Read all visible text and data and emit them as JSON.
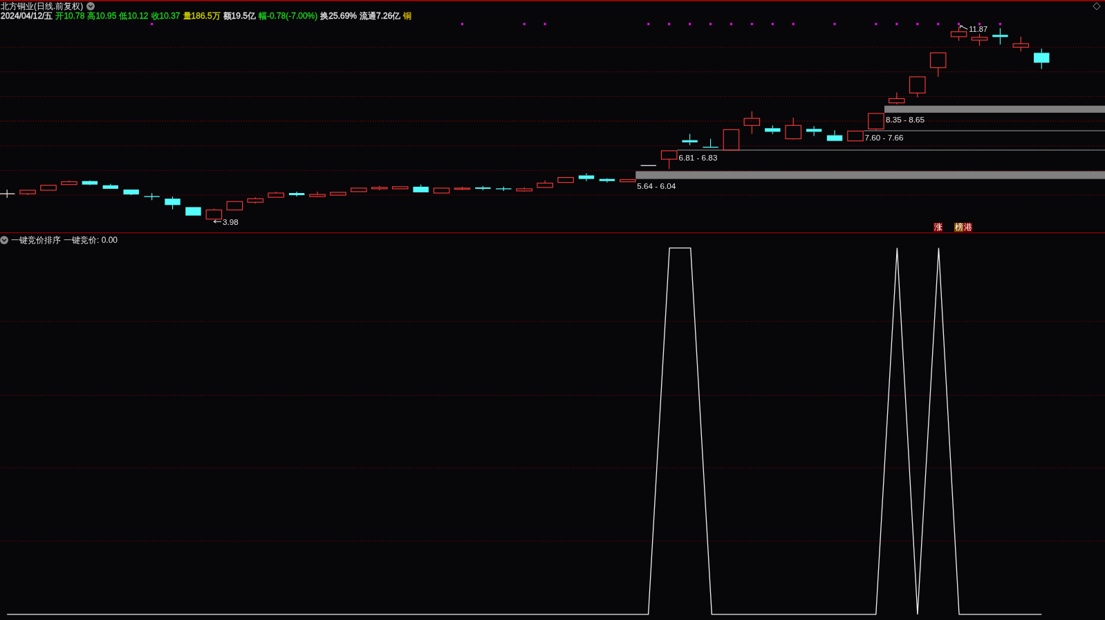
{
  "title_bar": {
    "title": "北方铜业(日线.前复权)"
  },
  "quote": [
    {
      "text": "2024/04/12/五",
      "color": "#e6e6e6"
    },
    {
      "text": "开10.78",
      "color": "#1ed31e"
    },
    {
      "text": "高10.95",
      "color": "#1ed31e"
    },
    {
      "text": "低10.12",
      "color": "#1ed31e"
    },
    {
      "text": "收10.37",
      "color": "#1ed31e"
    },
    {
      "text": "量186.5万",
      "color": "#d2d200"
    },
    {
      "text": "额19.5亿",
      "color": "#e6e6e6"
    },
    {
      "text": "幅-0.78(-7.00%)",
      "color": "#1ed31e"
    },
    {
      "text": "换25.69%",
      "color": "#e6e6e6"
    },
    {
      "text": "流通7.26亿",
      "color": "#e6e6e6"
    },
    {
      "text": "铜",
      "color": "#d8b800"
    }
  ],
  "main_chart": {
    "high_label": "11.87",
    "low_label": "3.98",
    "zones": [
      {
        "kind": "band",
        "label": "5.64 - 6.04"
      },
      {
        "kind": "line",
        "label": "6.81 - 6.83"
      },
      {
        "kind": "line",
        "label": "7.60 - 7.66"
      },
      {
        "kind": "band",
        "label": "8.35 - 8.65"
      }
    ],
    "tags": [
      {
        "text": "涨",
        "color": "#8c0000"
      },
      {
        "text": "榜",
        "color": "#8c4a00"
      },
      {
        "text": "港",
        "color": "#8c0000"
      }
    ]
  },
  "indicator": {
    "title": "一键竞价排序",
    "reading": "一键竞价: 0.00"
  }
}
